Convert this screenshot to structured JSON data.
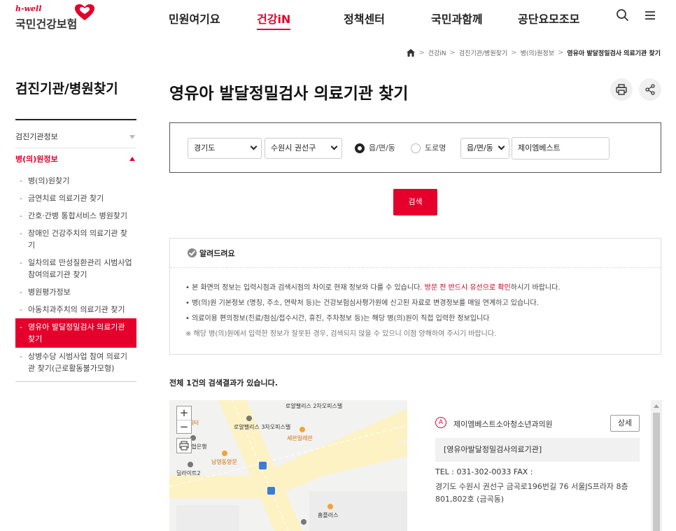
{
  "header": {
    "logo_small": "h-well",
    "logo_main": "국민건강보험",
    "nav": [
      {
        "label": "민원여기요",
        "active": false
      },
      {
        "label": "건강iN",
        "active": true
      },
      {
        "label": "정책센터",
        "active": false
      },
      {
        "label": "국민과함께",
        "active": false
      },
      {
        "label": "공단요모조모",
        "active": false
      }
    ],
    "icons": [
      "search-icon",
      "hamburger-menu-icon"
    ]
  },
  "breadcrumb": {
    "items": [
      "건강iN",
      "검진기관/병원찾기",
      "병(의)원정보"
    ],
    "current": "영유아 발달정밀검사 의료기관 찾기"
  },
  "sidebar": {
    "title": "검진기관/병원찾기",
    "groups": [
      {
        "label": "검진기관정보",
        "open": false
      },
      {
        "label": "병(의)원정보",
        "open": true
      }
    ],
    "sub_items": [
      {
        "label": "병(의)원찾기"
      },
      {
        "label": "금연치료 의료기관 찾기"
      },
      {
        "label": "간호·간병 통합서비스 병원찾기"
      },
      {
        "label": "장애인 건강주치의 의료기관 찾기"
      },
      {
        "label": "일차의료 만성질환관리 시범사업 참여의료기관 찾기"
      },
      {
        "label": "병원평가정보"
      },
      {
        "label": "아동치과주치의 의료기관 찾기"
      },
      {
        "label": "영유아 발달정밀검사 의료기관 찾기",
        "active": true
      },
      {
        "label": "상병수당 시범사업 참여 의료기관 찾기(근로활동불가모형)"
      }
    ]
  },
  "main": {
    "title": "영유아 발달정밀검사 의료기관 찾기",
    "search": {
      "sido": "경기도",
      "sigungu": "수원시 권선구",
      "radio_1": "읍/면/동",
      "radio_2": "도로명",
      "radio_selected": "읍/면/동",
      "type_select": "읍/면/동",
      "keyword": "제이엠베스트",
      "button": "검색"
    },
    "notice": {
      "title": "알려드려요",
      "line1_pre": "• 본 화면의 정보는 입력시점과 검색시점의 차이로 현재 정보와 다를 수 있습니다. ",
      "line1_hl": "방문 전 반드시 유선으로 확인",
      "line1_post": "하시기 바랍니다.",
      "line2": "• 병(의)원 기본정보 (명칭, 주소, 연락처 등)는 건강보험심사평가원에 신고된 자료로 변경정보를 매일 연계하고 있습니다.",
      "line3": "• 의료이용 편의정보(진료/점심/접수시간, 휴진, 주차정보 등)는 해당 병(의)원이 직접 입력한 정보입니다",
      "note": "※ 해당 병(의)원에서 입력한 정보가 잘못된 경우, 검색되지 않을 수 있으니 이점 양해하여 주시기 바랍니다."
    },
    "result_count": "전체 1건의 검색결과가 있습니다.",
    "map": {
      "zoom_in": "+",
      "zoom_out": "−",
      "labels": [
        "로얄팰리스 2차오피스텔",
        "로얄팰리스 3차오피스텔",
        "세븐일레븐",
        "남영동양문",
        "농협은행",
        "딜라이트2",
        "홈플러스",
        "드피터"
      ]
    },
    "result": {
      "marker": "A",
      "name": "제이엠베스트소아청소년과의원",
      "detail_button": "상세",
      "tag": "[영유아발달정밀검사의료기관]",
      "tel": "TEL : 031-302-0033   FAX :",
      "address": "경기도 수원시 권선구 금곡로196번길 76 서울JS프라자 8층 801,802호 (금곡동)"
    }
  },
  "colors": {
    "accent": "#e4002b",
    "text": "#222222",
    "map_road": "#fdf2c4"
  }
}
